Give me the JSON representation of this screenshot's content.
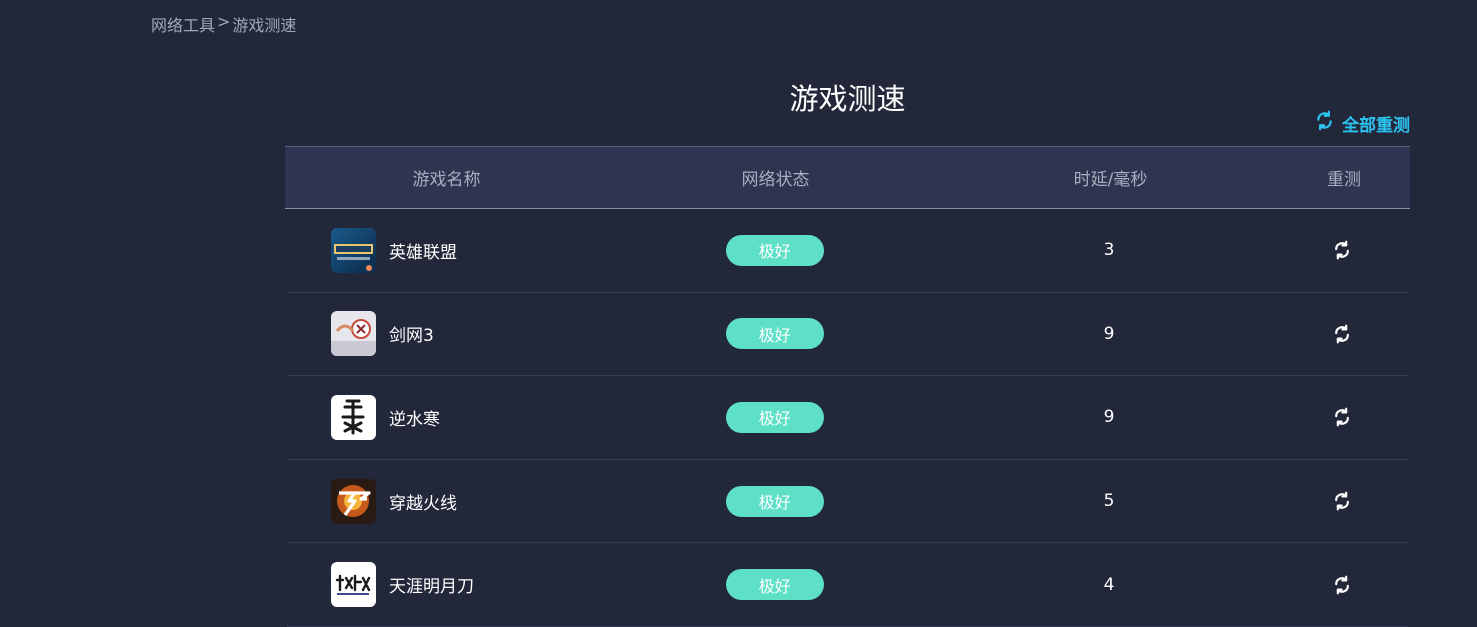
{
  "breadcrumb": {
    "parent": "网络工具",
    "separator": ">",
    "current": "游戏测速"
  },
  "page_title": "游戏测速",
  "retest_all": {
    "label": "全部重测",
    "color": "#2cc3ef"
  },
  "table": {
    "headers": {
      "name": "游戏名称",
      "status": "网络状态",
      "latency": "时延/毫秒",
      "retest": "重测"
    },
    "rows": [
      {
        "name": "英雄联盟",
        "status": "极好",
        "latency": "3",
        "icon": "lol-game-icon"
      },
      {
        "name": "剑网3",
        "status": "极好",
        "latency": "9",
        "icon": "jx3-game-icon"
      },
      {
        "name": "逆水寒",
        "status": "极好",
        "latency": "9",
        "icon": "nishuihan-game-icon"
      },
      {
        "name": "穿越火线",
        "status": "极好",
        "latency": "5",
        "icon": "crossfire-game-icon"
      },
      {
        "name": "天涯明月刀",
        "status": "极好",
        "latency": "4",
        "icon": "tianya-game-icon"
      }
    ]
  },
  "colors": {
    "background": "#22273a",
    "header_bg": "#2f3450",
    "status_good": "#5de0c6",
    "accent": "#2cc3ef"
  }
}
